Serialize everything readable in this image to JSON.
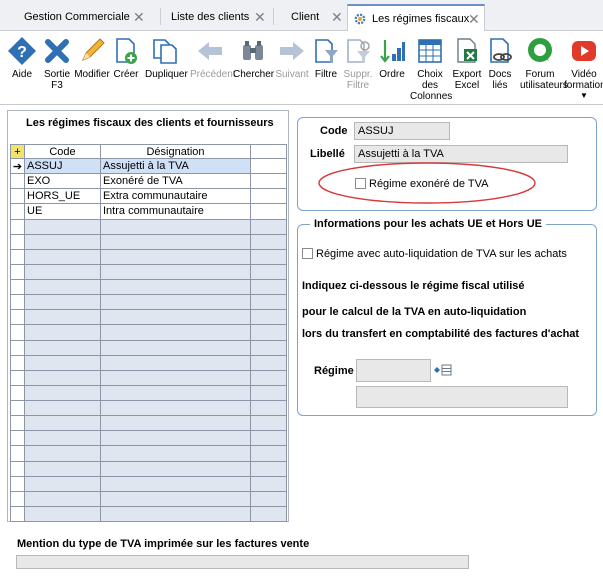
{
  "tabs": [
    {
      "label": "Gestion Commerciale"
    },
    {
      "label": "Liste des clients"
    },
    {
      "label": "Client"
    },
    {
      "label": "Les régimes fiscaux"
    }
  ],
  "toolbar": {
    "items": [
      {
        "label": "Aide",
        "label2": "",
        "icon": "help-diamond-icon"
      },
      {
        "label": "Sortie",
        "label2": "F3",
        "icon": "close-x-icon"
      },
      {
        "label": "Modifier",
        "label2": "",
        "icon": "pencil-icon"
      },
      {
        "label": "Créer",
        "label2": "",
        "icon": "new-document-icon"
      },
      {
        "label": "Dupliquer",
        "label2": "",
        "icon": "duplicate-icon"
      },
      {
        "label": "Précédent",
        "label2": "",
        "icon": "arrow-left-icon"
      },
      {
        "label": "Chercher",
        "label2": "",
        "icon": "binoculars-icon"
      },
      {
        "label": "Suivant",
        "label2": "",
        "icon": "arrow-right-icon"
      },
      {
        "label": "Filtre",
        "label2": "",
        "icon": "filter-icon"
      },
      {
        "label": "Suppr.",
        "label2": "Filtre",
        "icon": "remove-filter-icon"
      },
      {
        "label": "Ordre",
        "label2": "",
        "icon": "sort-order-icon"
      },
      {
        "label": "Choix",
        "label2": "des",
        "label3": "Colonnes",
        "icon": "columns-icon"
      },
      {
        "label": "Export",
        "label2": "Excel",
        "icon": "excel-icon"
      },
      {
        "label": "Docs",
        "label2": "liés",
        "icon": "linked-docs-icon"
      },
      {
        "label": "Forum",
        "label2": "utilisateurs",
        "icon": "forum-icon"
      },
      {
        "label": "Vidéo",
        "label2": "formation",
        "icon": "video-icon"
      }
    ]
  },
  "left_panel": {
    "title": "Les régimes fiscaux des clients et fournisseurs",
    "add_icon": "+",
    "col_code": "Code",
    "col_designation": "Désignation",
    "rows": [
      {
        "code": "ASSUJ",
        "designation": "Assujetti à la TVA"
      },
      {
        "code": "EXO",
        "designation": "Exonéré de TVA"
      },
      {
        "code": "HORS_UE",
        "designation": "Extra communautaire"
      },
      {
        "code": "UE",
        "designation": "Intra communautaire"
      }
    ]
  },
  "detail": {
    "code_label": "Code",
    "code_value": "ASSUJ",
    "libelle_label": "Libellé",
    "libelle_value": "Assujetti à la TVA",
    "exonere_label": "Régime exonéré de TVA"
  },
  "ue": {
    "group_title": "Informations pour les achats UE et Hors UE",
    "autoliq_label": "Régime avec auto-liquidation de TVA sur les achats",
    "line1": "Indiquez ci-dessous le régime fiscal utilisé",
    "line2": "pour le calcul de la TVA en auto-liquidation",
    "line3": "lors du transfert en comptabilité des factures d'achat",
    "regime_label": "Régime"
  },
  "footer": {
    "mention_label": "Mention du type de TVA imprimée sur les factures vente"
  },
  "colors": {
    "accent": "#2f6fb3",
    "highlight_ellipse": "#d63a3a",
    "selected_row": "#cfe0f7"
  }
}
